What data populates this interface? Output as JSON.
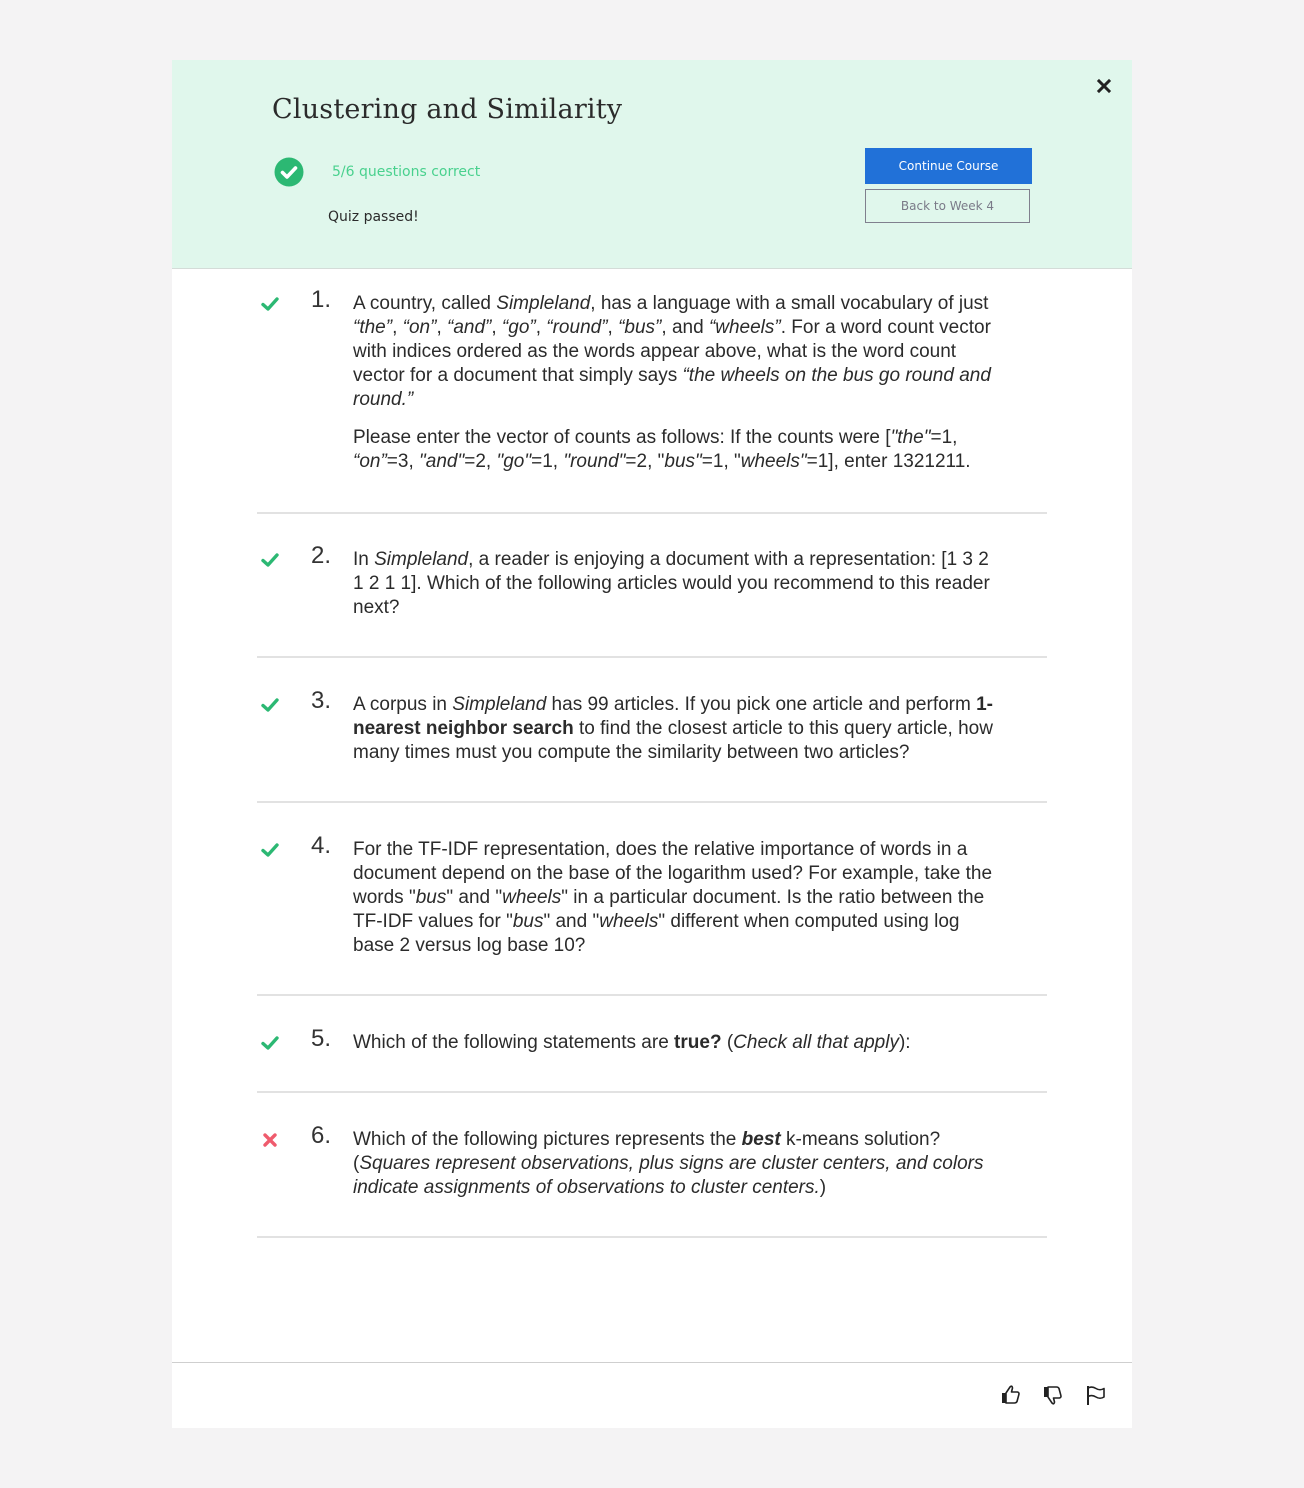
{
  "header": {
    "title": "Clustering and Similarity",
    "score_text": "5/6 questions correct",
    "status_text": "Quiz passed!",
    "continue_label": "Continue Course",
    "back_label": "Back to Week 4",
    "close_icon": "close-icon",
    "pass_icon": "check-circle-icon"
  },
  "colors": {
    "header_bg": "#e0f7ec",
    "correct": "#2cb873",
    "incorrect": "#ef5b6d",
    "primary": "#2171d8",
    "score_text": "#49d18e"
  },
  "questions": [
    {
      "number": "1.",
      "status": "correct",
      "paragraphs": [
        [
          {
            "t": "A country, called "
          },
          {
            "t": "Simpleland",
            "i": true
          },
          {
            "t": ", has a language with a small vocabulary of just "
          },
          {
            "t": "“the”",
            "i": true
          },
          {
            "t": ", "
          },
          {
            "t": "“on”",
            "i": true
          },
          {
            "t": ", "
          },
          {
            "t": "“and”",
            "i": true
          },
          {
            "t": ", "
          },
          {
            "t": "“go”",
            "i": true
          },
          {
            "t": ", "
          },
          {
            "t": "“round”",
            "i": true
          },
          {
            "t": ", "
          },
          {
            "t": "“bus”",
            "i": true
          },
          {
            "t": ", and "
          },
          {
            "t": "“wheels”",
            "i": true
          },
          {
            "t": ". For a word count vector with indices ordered as the words appear above, what is the word count vector for a document that simply says "
          },
          {
            "t": "“the wheels on the bus go round and round.”",
            "i": true
          }
        ],
        [
          {
            "t": "Please enter the vector of counts as follows: If the counts were ["
          },
          {
            "t": "\"the\"",
            "i": true
          },
          {
            "t": "=1, "
          },
          {
            "t": "“on”",
            "i": true
          },
          {
            "t": "=3, "
          },
          {
            "t": "\"and\"",
            "i": true
          },
          {
            "t": "=2, "
          },
          {
            "t": "\"go\"",
            "i": true
          },
          {
            "t": "=1, "
          },
          {
            "t": "\"round\"",
            "i": true
          },
          {
            "t": "=2, \""
          },
          {
            "t": "bus\"",
            "i": true
          },
          {
            "t": "=1, \""
          },
          {
            "t": "wheels\"",
            "i": true
          },
          {
            "t": "=1], enter 1321211."
          }
        ]
      ]
    },
    {
      "number": "2.",
      "status": "correct",
      "paragraphs": [
        [
          {
            "t": "In "
          },
          {
            "t": "Simpleland",
            "i": true
          },
          {
            "t": ", a reader is enjoying a document with a representation: [1 3 2 1 2 1 1]. Which of the following articles would you recommend to this reader next?"
          }
        ]
      ]
    },
    {
      "number": "3.",
      "status": "correct",
      "paragraphs": [
        [
          {
            "t": "A corpus in "
          },
          {
            "t": "Simpleland",
            "i": true
          },
          {
            "t": " has 99 articles. If you pick one article and perform "
          },
          {
            "t": "1-nearest neighbor search",
            "b": true
          },
          {
            "t": " to find the closest article to this query article, how many times must you compute the similarity between two articles?"
          }
        ]
      ]
    },
    {
      "number": "4.",
      "status": "correct",
      "paragraphs": [
        [
          {
            "t": "For the TF-IDF representation, does the relative importance of words in a document depend on the base of the logarithm used? For example, take the words \""
          },
          {
            "t": "bus",
            "i": true
          },
          {
            "t": "\" and \""
          },
          {
            "t": "wheels",
            "i": true
          },
          {
            "t": "\" in a particular document. Is the ratio between the TF-IDF values for \""
          },
          {
            "t": "bus",
            "i": true
          },
          {
            "t": "\" and \""
          },
          {
            "t": "wheels",
            "i": true
          },
          {
            "t": "\" different when computed using log base 2 versus log base 10?"
          }
        ]
      ]
    },
    {
      "number": "5.",
      "status": "correct",
      "paragraphs": [
        [
          {
            "t": "Which of the following statements are "
          },
          {
            "t": "true?",
            "b": true
          },
          {
            "t": " ("
          },
          {
            "t": "Check all that apply",
            "i": true
          },
          {
            "t": "):"
          }
        ]
      ]
    },
    {
      "number": "6.",
      "status": "incorrect",
      "paragraphs": [
        [
          {
            "t": "Which of the following pictures represents the "
          },
          {
            "t": "best",
            "b": true,
            "i": true
          },
          {
            "t": " k-means solution? ("
          },
          {
            "t": "Squares represent observations, plus signs are cluster centers, and colors indicate assignments of observations to cluster centers.",
            "i": true
          },
          {
            "t": ")"
          }
        ]
      ]
    }
  ],
  "footer": {
    "like_icon": "thumbs-up-icon",
    "dislike_icon": "thumbs-down-icon",
    "flag_icon": "flag-icon"
  }
}
